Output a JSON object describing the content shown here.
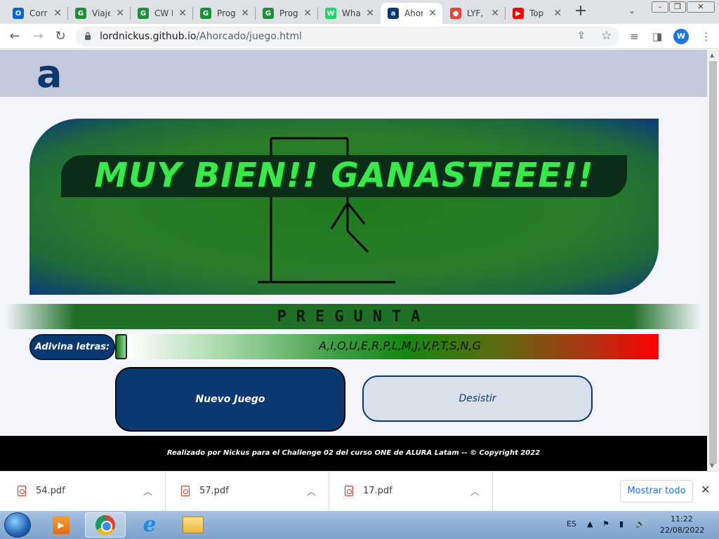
{
  "browser": {
    "tabs": [
      {
        "title": "Corr",
        "icon": "outlook-icon",
        "icon_color": "#0a64d2",
        "icon_text": "O",
        "active": false
      },
      {
        "title": "Viaje",
        "icon": "sheets-icon",
        "icon_color": "#1e8e3e",
        "icon_text": "G",
        "active": false
      },
      {
        "title": "CW I",
        "icon": "sheets-icon",
        "icon_color": "#1e8e3e",
        "icon_text": "G",
        "active": false
      },
      {
        "title": "Prog",
        "icon": "sheets-icon",
        "icon_color": "#1e8e3e",
        "icon_text": "G",
        "active": false
      },
      {
        "title": "Prog",
        "icon": "sheets-icon",
        "icon_color": "#1e8e3e",
        "icon_text": "G",
        "active": false
      },
      {
        "title": "Wha",
        "icon": "whatsapp-icon",
        "icon_color": "#25d366",
        "icon_text": "W",
        "active": false
      },
      {
        "title": "Ahor",
        "icon": "alura-icon",
        "icon_color": "#0a3871",
        "icon_text": "a",
        "active": true
      },
      {
        "title": "LYF,",
        "icon": "maps-pin-icon",
        "icon_color": "#ea4335",
        "icon_text": "●",
        "active": false
      },
      {
        "title": "Top",
        "icon": "youtube-icon",
        "icon_color": "#ff0000",
        "icon_text": "▶",
        "active": false
      }
    ],
    "url_host": "lordnickus.github.io",
    "url_path": "/Ahorcado/juego.html",
    "profile_initial": "W"
  },
  "page": {
    "logo": "a",
    "win_message": "MUY BIEN!! GANASTEEE!!",
    "question_label": "PREGUNTA",
    "guess_label": "Adivina letras:",
    "letters_used": "A,I,O,U,E,R,P,L,M,J,V,P,T,S,N,G",
    "new_game_label": "Nuevo Juego",
    "give_up_label": "Desistir",
    "footer": "Realizado por Nickus para el Challenge 02 del curso ONE de ALURA Latam -- © Copyright 2022"
  },
  "downloads": {
    "items": [
      {
        "name": "54.pdf"
      },
      {
        "name": "57.pdf"
      },
      {
        "name": "17.pdf"
      }
    ],
    "show_all_label": "Mostrar todo"
  },
  "taskbar": {
    "lang": "ES",
    "time": "11:22",
    "date": "22/08/2022"
  },
  "colors": {
    "alura_blue": "#0a3871",
    "win_green": "#39e84a",
    "board_green": "#2a7d2a"
  }
}
